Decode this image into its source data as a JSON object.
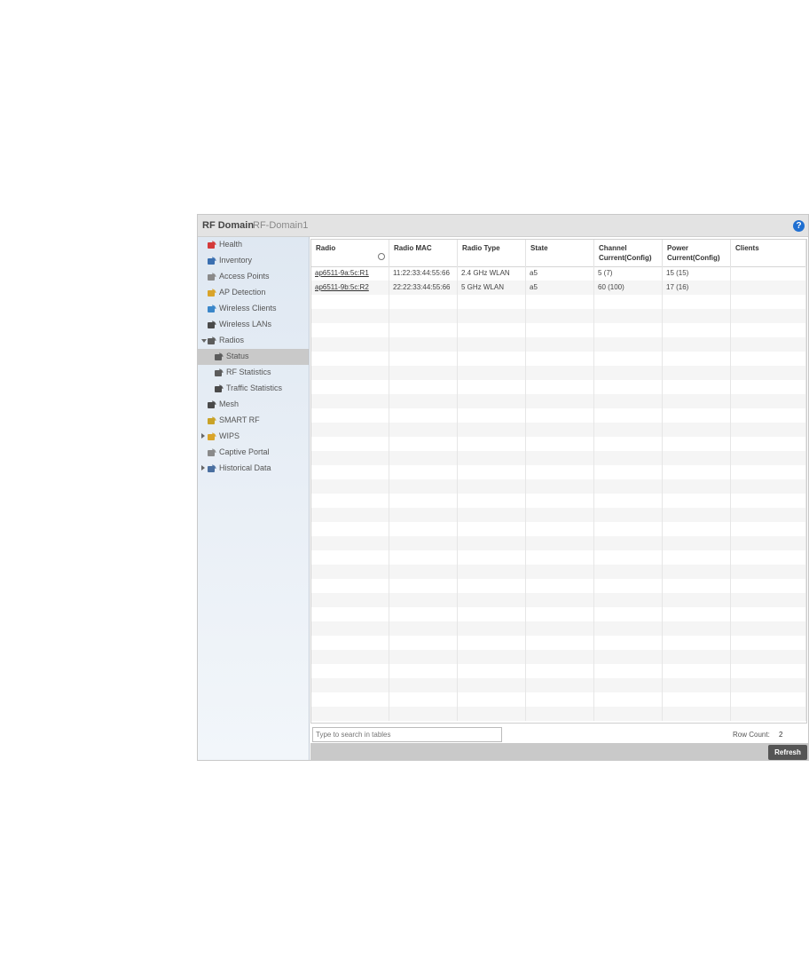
{
  "header": {
    "title": "RF Domain",
    "subtitle": "RF-Domain1",
    "help_icon": "?"
  },
  "sidebar": {
    "items": [
      {
        "label": "Health",
        "icon": "health-icon"
      },
      {
        "label": "Inventory",
        "icon": "inventory-icon"
      },
      {
        "label": "Access Points",
        "icon": "access-point-icon"
      },
      {
        "label": "AP Detection",
        "icon": "ap-detection-icon"
      },
      {
        "label": "Wireless Clients",
        "icon": "wireless-client-icon"
      },
      {
        "label": "Wireless LANs",
        "icon": "wlan-icon"
      },
      {
        "label": "Radios",
        "icon": "radio-icon",
        "expanded": true
      },
      {
        "label": "Status",
        "icon": "radio-status-icon",
        "selected": true
      },
      {
        "label": "RF Statistics",
        "icon": "rf-statistics-icon"
      },
      {
        "label": "Traffic Statistics",
        "icon": "traffic-statistics-icon"
      },
      {
        "label": "Mesh",
        "icon": "mesh-icon"
      },
      {
        "label": "SMART RF",
        "icon": "smart-rf-icon"
      },
      {
        "label": "WIPS",
        "icon": "wips-icon",
        "expanded": false
      },
      {
        "label": "Captive Portal",
        "icon": "captive-portal-icon"
      },
      {
        "label": "Historical Data",
        "icon": "historical-data-icon",
        "expanded": false
      }
    ]
  },
  "table": {
    "columns": [
      "Radio",
      "Radio MAC",
      "Radio Type",
      "State",
      "Channel Current(Config)",
      "Power Current(Config)",
      "Clients"
    ],
    "rows": [
      [
        "ap6511-9a:5c:R1",
        "11:22:33:44:55:66",
        "2.4 GHz WLAN",
        "a5",
        "5 (7)",
        "15 (15)",
        ""
      ],
      [
        "ap6511-9b:5c:R2",
        "22:22:33:44:55:66",
        "5 GHz WLAN",
        "a5",
        "60 (100)",
        "17 (16)",
        ""
      ]
    ]
  },
  "footer": {
    "search_placeholder": "Type to search in tables",
    "row_count_label": "Row Count:",
    "row_count": "2",
    "refresh_label": "Refresh"
  },
  "colors": {
    "accent": "#1f6fd1",
    "selected": "#c9c9c9",
    "action_bar": "#c9c9c9",
    "button": "#555555"
  }
}
